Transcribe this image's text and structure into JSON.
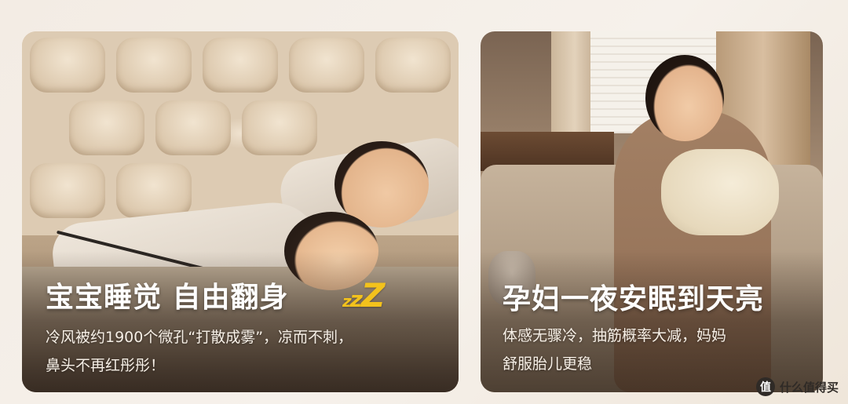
{
  "cards": [
    {
      "title": "宝宝睡觉 自由翻身",
      "decoration": "zzz",
      "description_lines": [
        "冷风被约1900个微孔“打散成雾”，凉而不刺，",
        "鼻头不再红彤彤！"
      ]
    },
    {
      "title": "孕妇一夜安眠到天亮",
      "description_lines": [
        "体感无骤冷，抽筋概率大减，妈妈",
        "舒服胎儿更稳"
      ]
    }
  ],
  "watermark": {
    "logo_text": "值",
    "text": "什么值得买"
  },
  "colors": {
    "zzz": "#f3c21c",
    "title_text": "#ffffff",
    "desc_text": "#f6efe6"
  }
}
